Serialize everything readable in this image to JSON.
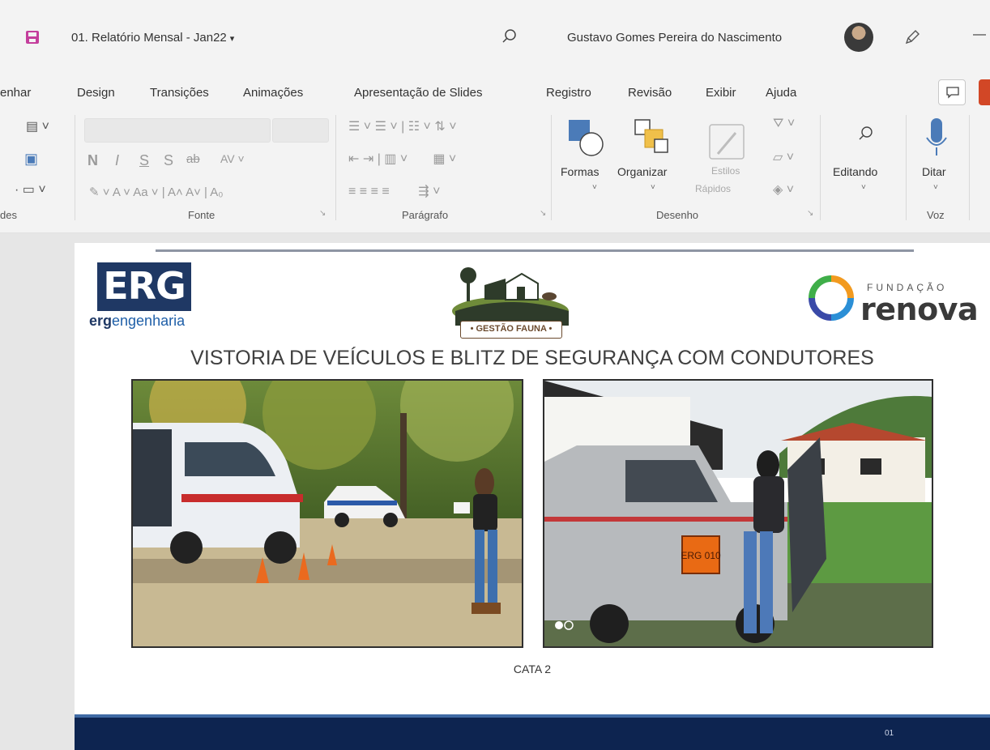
{
  "titlebar": {
    "doc_title": "01. Relatório Mensal - Jan22",
    "user_name": "Gustavo Gomes Pereira do Nascimento"
  },
  "tabs": [
    {
      "label": "enhar"
    },
    {
      "label": "Design"
    },
    {
      "label": "Transições"
    },
    {
      "label": "Animações"
    },
    {
      "label": "Apresentação de Slides"
    },
    {
      "label": "Registro"
    },
    {
      "label": "Revisão"
    },
    {
      "label": "Exibir"
    },
    {
      "label": "Ajuda"
    }
  ],
  "ribbon": {
    "groups": {
      "slides": "des",
      "font": "Fonte",
      "paragraph": "Parágrafo",
      "drawing": "Desenho",
      "voice": "Voz"
    },
    "buttons": {
      "formas": "Formas",
      "organizar": "Organizar",
      "estilos_1": "Estilos",
      "estilos_2": "Rápidos",
      "editando": "Editando",
      "ditar": "Ditar"
    }
  },
  "slide": {
    "erg_logo": "ERG",
    "erg_sub_bold": "erg",
    "erg_sub_rest": "engenharia",
    "fauna_label": "• GESTÃO FAUNA •",
    "renova_top": "FUNDAÇÃO",
    "renova_name": "renova",
    "heading": "VISTORIA DE VEÍCULOS E BLITZ DE SEGURANÇA COM CONDUTORES",
    "photo_left_badge": "",
    "photo_right_plate": "ERG 010",
    "caption": "CATA 2",
    "page_number": "01"
  },
  "colors": {
    "accent_share": "#d24726",
    "slide_footer": "#0d2450",
    "erg_blue": "#1f3864"
  },
  "icons": [
    "save-icon",
    "search-icon",
    "pen-icon",
    "comment-icon",
    "microphone-icon",
    "shapes-icon",
    "arrange-icon",
    "quick-styles-icon"
  ]
}
